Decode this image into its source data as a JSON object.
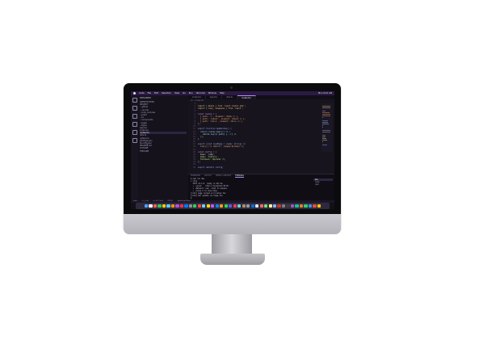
{
  "menubar": {
    "items": [
      "Code",
      "File",
      "Edit",
      "Selection",
      "View",
      "Go",
      "Run",
      "Terminal",
      "Window",
      "Help"
    ],
    "clock": "Mon 9:41 AM"
  },
  "explorer": {
    "title": "EXPLORER",
    "items": [
      "OPEN EDITORS",
      "PROJECT",
      "› .github",
      "› .vscode",
      "› node_modules",
      "› public",
      "› src",
      "  › components",
      "  › pages",
      "  › styles",
      "  App.tsx",
      "  index.tsx",
      "  routes.tsx",
      "  utils.ts",
      ".gitignore",
      "package.json",
      "tsconfig.json",
      "README.md",
      "OUTLINE",
      "TIMELINE"
    ],
    "selected_index": 12
  },
  "editor": {
    "tabs": [
      "index.tsx",
      "App.tsx",
      "utils.ts",
      "routes.tsx"
    ],
    "active_tab": 3,
    "breadcrumb": "src › routes.tsx",
    "code": [
      {
        "t": "",
        "c": "#c9c4d8"
      },
      {
        "t": "import { Route } from 'react-router-dom';",
        "c": "#f0c674"
      },
      {
        "t": "import { lazy, Suspense } from 'react';",
        "c": "#f0c674"
      },
      {
        "t": "",
        "c": "#c9c4d8"
      },
      {
        "t": "const routes = [",
        "c": "#c792ea"
      },
      {
        "t": "  { path: '/', element: <Home /> },",
        "c": "#e6a26a"
      },
      {
        "t": "  { path: '/about', element: <About /> },",
        "c": "#e6a26a"
      },
      {
        "t": "  { path: '/docs', element: <Docs /> },",
        "c": "#e6a26a"
      },
      {
        "t": "];",
        "c": "#c9c4d8"
      },
      {
        "t": "",
        "c": "#c9c4d8"
      },
      {
        "t": "export function AppRoutes() {",
        "c": "#82aaff"
      },
      {
        "t": "  return routes.map((r) => (",
        "c": "#c9c4d8"
      },
      {
        "t": "    <Route key={r.path} {...r} />",
        "c": "#89ddff"
      },
      {
        "t": "  ));",
        "c": "#c9c4d8"
      },
      {
        "t": "}",
        "c": "#c9c4d8"
      },
      {
        "t": "",
        "c": "#c9c4d8"
      },
      {
        "t": "export const loadPage = (name: string) =>",
        "c": "#82aaff"
      },
      {
        "t": "  lazy(() => import(`./pages/${name}`));",
        "c": "#e6a26a"
      },
      {
        "t": "",
        "c": "#c9c4d8"
      },
      {
        "t": "const config = {",
        "c": "#c792ea"
      },
      {
        "t": "  base: '/app',",
        "c": "#c3e88d"
      },
      {
        "t": "  mode: 'history',",
        "c": "#c3e88d"
      },
      {
        "t": "  fallback: <Spinner />,",
        "c": "#c3e88d"
      },
      {
        "t": "};",
        "c": "#c9c4d8"
      },
      {
        "t": "",
        "c": "#c9c4d8"
      },
      {
        "t": "export default config;",
        "c": "#82aaff"
      }
    ]
  },
  "panel": {
    "tabs": [
      "PROBLEMS",
      "OUTPUT",
      "DEBUG CONSOLE",
      "TERMINAL"
    ],
    "active_tab": 3,
    "terminal_lines": [
      "$ npm run dev",
      "> vite",
      "  VITE v4.4.9  ready in 412 ms",
      "  ➜  Local:   http://localhost:5173/",
      "  ➜  Network: use --host to expose",
      "  ➜  press h to show help",
      "[vite] page reload src/routes.tsx",
      "[vite] hmr update /src/App.tsx",
      "$ "
    ],
    "sessions": [
      "zsh",
      "node",
      "npm"
    ],
    "active_session": 0
  },
  "statusbar": {
    "items": [
      "main",
      "0 △ 0 ⊗",
      "Ln 12, Col 4",
      "UTF-8",
      "TypeScript React"
    ]
  },
  "dock": {
    "colors": [
      "#4aa3ff",
      "#ffffff",
      "#ff5f57",
      "#34c759",
      "#ffcc00",
      "#5ac8fa",
      "#ff9500",
      "#af52de",
      "#ff2d55",
      "#007aff",
      "#8e8e93",
      "#30d158",
      "#ff453a",
      "#64d2ff",
      "#ffd60a",
      "#bf5af2",
      "#0a84ff",
      "#ff9f0a",
      "#32d74b",
      "#5e5ce6",
      "#ff375f",
      "#66d4cf",
      "#ac8e68",
      "#98989d",
      "#0071e3",
      "#e5e5ea",
      "#ff6961",
      "#77dd77",
      "#fdfd96",
      "#84b6f4",
      "#c23b22",
      "#7d7d7d",
      "#3a3a3c",
      "#9b59b6",
      "#1abc9c",
      "#e67e22",
      "#2ecc71",
      "#3498db",
      "#e74c3c",
      "#f1c40f"
    ]
  }
}
